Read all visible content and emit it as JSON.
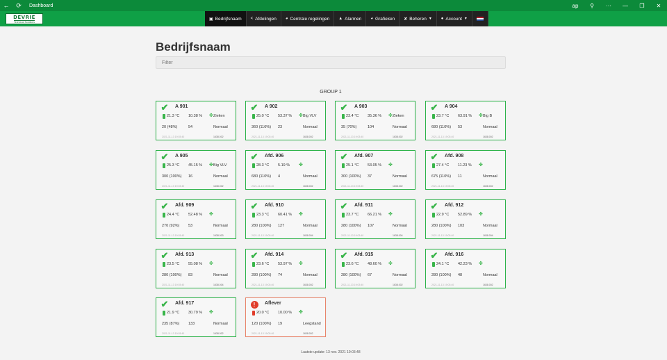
{
  "window": {
    "title": "Dashboard",
    "back_icon": "arrow-left-icon",
    "refresh_icon": "refresh-icon"
  },
  "navbar": {
    "logo_text": "DEVRIE",
    "logo_subtext": "Technical Solutions",
    "menu": [
      {
        "label": "Bedrijfsnaam",
        "icon": "building-icon",
        "active": true
      },
      {
        "label": "Afdelingen",
        "icon": "share-icon"
      },
      {
        "label": "Centrale regelingen",
        "icon": "gauge-icon"
      },
      {
        "label": "Alarmen",
        "icon": "bell-icon"
      },
      {
        "label": "Grafieken",
        "icon": "chart-icon"
      },
      {
        "label": "Beheren",
        "icon": "wrench-icon",
        "dropdown": true
      },
      {
        "label": "Account",
        "icon": "user-icon",
        "dropdown": true
      }
    ],
    "flag_colors": [
      "#ae1c28",
      "#ffffff",
      "#21468b"
    ]
  },
  "page": {
    "title": "Bedrijfsnaam",
    "filter_placeholder": "Filter",
    "group_title": "GROUP 1",
    "last_update": "Laatste update: 13 nov. 2021 19:03:48"
  },
  "colors": {
    "accent": "#0fa046",
    "ok": "#39b54a",
    "alarm": "#e03c2a"
  },
  "cards": [
    {
      "name": "A 901",
      "status": "ok",
      "temp": "21.3 °C",
      "hum": "10.38 %",
      "product": "Zieken",
      "capacity": "20 (48%)",
      "count": "54",
      "mode": "Normaal",
      "stamp": "2021-11-13 19:03:40",
      "code": "1638.002"
    },
    {
      "name": "A 902",
      "status": "ok",
      "temp": "25.0 °C",
      "hum": "53.37 %",
      "product": "Big VLV",
      "capacity": "360 (116%)",
      "count": "23",
      "mode": "Normaal",
      "stamp": "2021-11-13 19:03:40",
      "code": "1638.002"
    },
    {
      "name": "A 903",
      "status": "ok",
      "temp": "23.4 °C",
      "hum": "35.36 %",
      "product": "Zieken",
      "capacity": "35 (70%)",
      "count": "104",
      "mode": "Normaal",
      "stamp": "2021-11-13 19:03:40",
      "code": "1638.002"
    },
    {
      "name": "A 904",
      "status": "ok",
      "temp": "23.7 °C",
      "hum": "63.91 %",
      "product": "Big B",
      "capacity": "680 (110%)",
      "count": "53",
      "mode": "Normaal",
      "stamp": "2021-11-13 19:03:40",
      "code": "1638.002"
    },
    {
      "name": "A 905",
      "status": "ok",
      "temp": "25.3 °C",
      "hum": "45.15 %",
      "product": "Big VLV",
      "capacity": "300 (100%)",
      "count": "16",
      "mode": "Normaal",
      "stamp": "2021-11-13 19:03:40",
      "code": "1638.002"
    },
    {
      "name": "Afd. 906",
      "status": "ok",
      "temp": "28.3 °C",
      "hum": "5.19 %",
      "product": "",
      "capacity": "680 (110%)",
      "count": "4",
      "mode": "Normaal",
      "stamp": "2021-11-13 19:03:40",
      "code": "1638.002"
    },
    {
      "name": "Afd. 907",
      "status": "ok",
      "temp": "25.1 °C",
      "hum": "53.05 %",
      "product": "",
      "capacity": "300 (100%)",
      "count": "37",
      "mode": "Normaal",
      "stamp": "2021-11-13 19:03:40",
      "code": "1638.002"
    },
    {
      "name": "Afd. 908",
      "status": "ok",
      "temp": "27.4 °C",
      "hum": "11.23 %",
      "product": "",
      "capacity": "675 (110%)",
      "count": "11",
      "mode": "Normaal",
      "stamp": "2021-11-13 19:03:40",
      "code": "1638.002"
    },
    {
      "name": "Afd. 909",
      "status": "ok",
      "temp": "24.4 °C",
      "hum": "52.48 %",
      "product": "",
      "capacity": "270 (92%)",
      "count": "53",
      "mode": "Normaal",
      "stamp": "2021-11-13 19:03:40",
      "code": "1638.003"
    },
    {
      "name": "Afd. 910",
      "status": "ok",
      "temp": "23.3 °C",
      "hum": "60.41 %",
      "product": "",
      "capacity": "280 (100%)",
      "count": "127",
      "mode": "Normaal",
      "stamp": "2021-11-13 19:03:40",
      "code": "1638.004"
    },
    {
      "name": "Afd. 911",
      "status": "ok",
      "temp": "23.7 °C",
      "hum": "66.21 %",
      "product": "",
      "capacity": "280 (100%)",
      "count": "107",
      "mode": "Normaal",
      "stamp": "2021-11-13 19:03:40",
      "code": "1638.004"
    },
    {
      "name": "Afd. 912",
      "status": "ok",
      "temp": "22.9 °C",
      "hum": "52.89 %",
      "product": "",
      "capacity": "280 (100%)",
      "count": "103",
      "mode": "Normaal",
      "stamp": "2021-11-13 19:03:40",
      "code": "1638.004"
    },
    {
      "name": "Afd. 913",
      "status": "ok",
      "temp": "23.5 °C",
      "hum": "55.08 %",
      "product": "",
      "capacity": "280 (100%)",
      "count": "83",
      "mode": "Normaal",
      "stamp": "2021-11-13 19:03:40",
      "code": "1638.004"
    },
    {
      "name": "Afd. 914",
      "status": "ok",
      "temp": "23.6 °C",
      "hum": "53.97 %",
      "product": "",
      "capacity": "280 (100%)",
      "count": "74",
      "mode": "Normaal",
      "stamp": "2021-11-13 19:03:40",
      "code": "1638.002"
    },
    {
      "name": "Afd. 915",
      "status": "ok",
      "temp": "23.6 °C",
      "hum": "48.60 %",
      "product": "",
      "capacity": "280 (100%)",
      "count": "67",
      "mode": "Normaal",
      "stamp": "2021-11-13 19:03:40",
      "code": "1638.002"
    },
    {
      "name": "Afd. 916",
      "status": "ok",
      "temp": "24.1 °C",
      "hum": "42.23 %",
      "product": "",
      "capacity": "280 (100%)",
      "count": "48",
      "mode": "Normaal",
      "stamp": "2021-11-13 19:03:40",
      "code": "1638.002"
    },
    {
      "name": "Afd. 917",
      "status": "ok",
      "temp": "21.9 °C",
      "hum": "30.79 %",
      "product": "",
      "capacity": "235 (87%)",
      "count": "133",
      "mode": "Normaal",
      "stamp": "2021-11-13 19:03:40",
      "code": "1638.002"
    },
    {
      "name": "Aflever",
      "status": "alarm",
      "temp": "20.0 °C",
      "hum": "10.00 %",
      "product": "",
      "capacity": "120 (100%)",
      "count": "19",
      "mode": "Leegstand",
      "stamp": "2021-11-13 19:03:40",
      "code": "1638.002"
    }
  ]
}
